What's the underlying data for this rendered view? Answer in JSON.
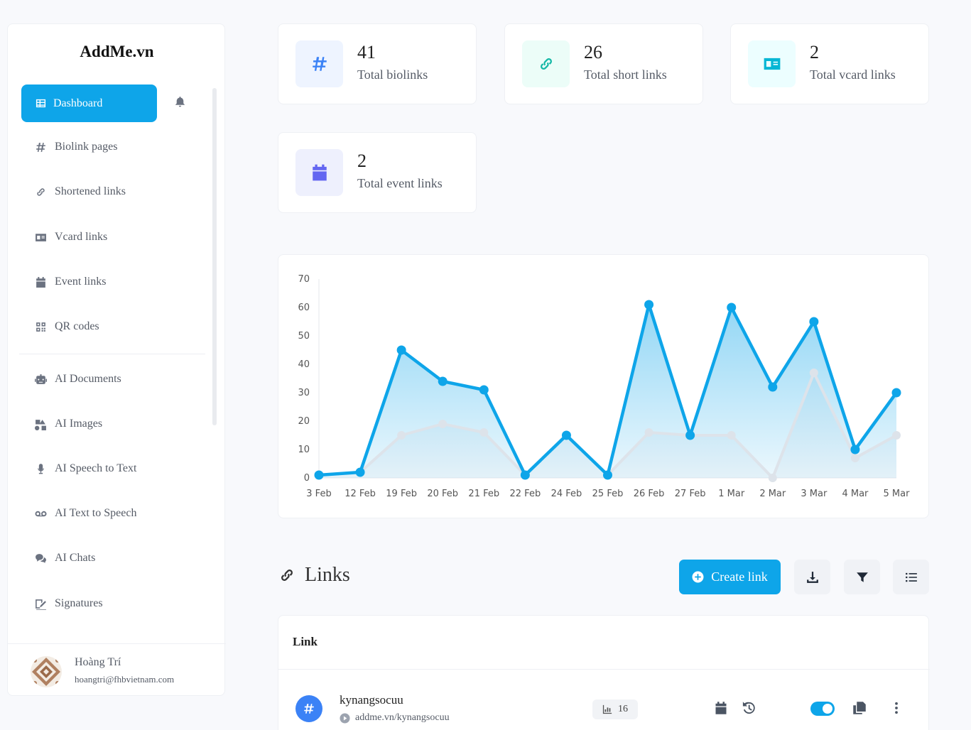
{
  "app": {
    "brand": "AddMe.vn"
  },
  "sidebar": {
    "active": {
      "label": "Dashboard",
      "icon": "table-icon"
    },
    "items": [
      {
        "label": "Biolink pages",
        "icon": "hash-icon"
      },
      {
        "label": "Shortened links",
        "icon": "link-icon"
      },
      {
        "label": "Vcard links",
        "icon": "id-card-icon"
      },
      {
        "label": "Event links",
        "icon": "calendar-icon"
      },
      {
        "label": "QR codes",
        "icon": "qrcode-icon"
      },
      {
        "label": "AI Documents",
        "icon": "robot-icon"
      },
      {
        "label": "AI Images",
        "icon": "icons-icon"
      },
      {
        "label": "AI Speech to Text",
        "icon": "microphone-icon"
      },
      {
        "label": "AI Text to Speech",
        "icon": "voicemail-icon"
      },
      {
        "label": "AI Chats",
        "icon": "comments-icon"
      },
      {
        "label": "Signatures",
        "icon": "signature-icon"
      }
    ],
    "user": {
      "name": "Hoàng Trí",
      "email": "hoangtri@fhbvietnam.com"
    }
  },
  "stats": [
    {
      "value": "41",
      "label": "Total biolinks",
      "icon": "hash-icon",
      "color": "#3b82f6",
      "bg": "#eef4ff"
    },
    {
      "value": "26",
      "label": "Total short links",
      "icon": "link-icon",
      "color": "#14b8a6",
      "bg": "#ecfdf8"
    },
    {
      "value": "2",
      "label": "Total vcard links",
      "icon": "id-card-icon",
      "color": "#06b6d4",
      "bg": "#ecfeff"
    },
    {
      "value": "2",
      "label": "Total event links",
      "icon": "calendar-icon",
      "color": "#6366f1",
      "bg": "#eef0fd"
    }
  ],
  "chart_data": {
    "type": "area",
    "categories": [
      "3 Feb",
      "12 Feb",
      "19 Feb",
      "20 Feb",
      "21 Feb",
      "22 Feb",
      "24 Feb",
      "25 Feb",
      "26 Feb",
      "27 Feb",
      "1 Mar",
      "2 Mar",
      "3 Mar",
      "4 Mar",
      "5 Mar"
    ],
    "series": [
      {
        "values": [
          1,
          2,
          45,
          34,
          31,
          1,
          15,
          1,
          61,
          15,
          60,
          32,
          55,
          10,
          30
        ],
        "color": "#0ea5e9"
      },
      {
        "values": [
          1,
          2,
          15,
          19,
          16,
          1,
          15,
          1,
          16,
          15,
          15,
          0,
          37,
          7,
          15
        ],
        "color": "#dde3ea"
      }
    ],
    "ylim": [
      0,
      70
    ],
    "yticks": [
      0,
      10,
      20,
      30,
      40,
      50,
      60,
      70
    ]
  },
  "links": {
    "title": "Links",
    "create_label": "Create link",
    "column_header": "Link",
    "rows": [
      {
        "title": "kynangsocuu",
        "url": "addme.vn/kynangsocuu",
        "pageviews": "16"
      }
    ]
  }
}
